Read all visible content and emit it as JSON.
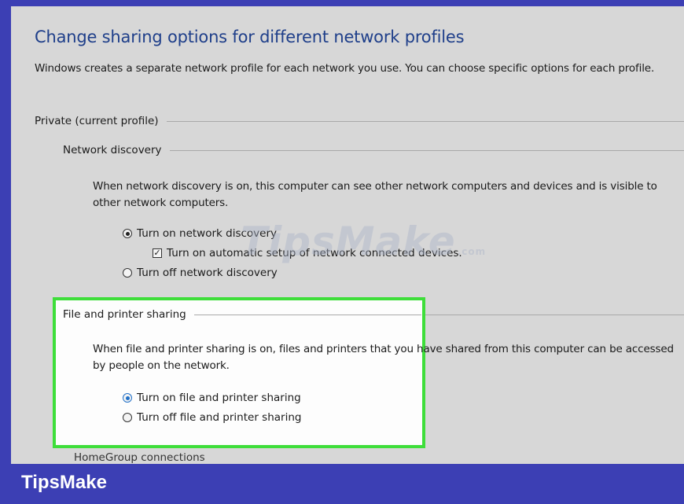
{
  "page": {
    "title": "Change sharing options for different network profiles",
    "description": "Windows creates a separate network profile for each network you use. You can choose specific options for each profile."
  },
  "private_profile": {
    "label": "Private (current profile)",
    "network_discovery": {
      "label": "Network discovery",
      "description": "When network discovery is on, this computer can see other network computers and devices and is visible to other network computers.",
      "turn_on_label": "Turn on network discovery",
      "turn_on_selected": true,
      "auto_setup_label": "Turn on automatic setup of network connected devices.",
      "auto_setup_checked": true,
      "turn_off_label": "Turn off network discovery",
      "turn_off_selected": false
    },
    "file_printer_sharing": {
      "label": "File and printer sharing",
      "description": "When file and printer sharing is on, files and printers that you have shared from this computer can be accessed by people on the network.",
      "turn_on_label": "Turn on file and printer sharing",
      "turn_on_selected": true,
      "turn_off_label": "Turn off file and printer sharing",
      "turn_off_selected": false
    },
    "cutoff_section_label": "HomeGroup connections"
  },
  "watermark": {
    "text": "TipsMake",
    "suffix": ".com"
  },
  "footer": {
    "brand": "TipsMake"
  },
  "colors": {
    "frame": "#3c3fb4",
    "title": "#1f3f8a",
    "highlight": "#3ede3a",
    "selected_radio": "#1f6fc7"
  }
}
